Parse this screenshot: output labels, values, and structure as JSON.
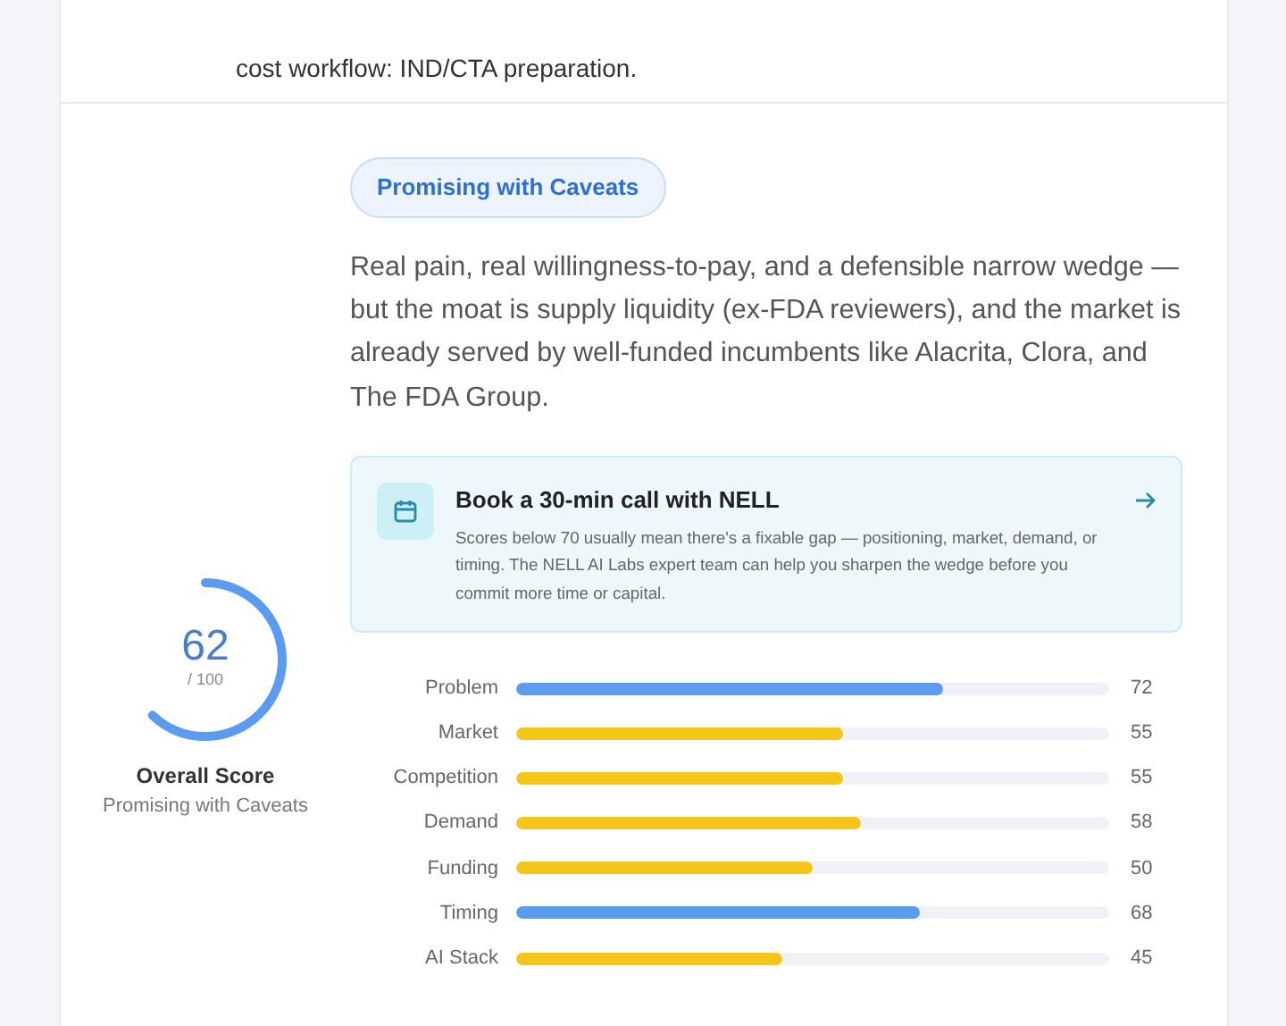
{
  "summary": {
    "text": "cost workflow: IND/CTA preparation."
  },
  "verdict": {
    "badge": "Promising with Caveats",
    "text": "Real pain, real willingness-to-pay, and a defensible narrow wedge — but the moat is supply liquidity (ex-FDA reviewers), and the market is already served by well-funded incumbents like Alacrita, Clora, and The FDA Group."
  },
  "score": {
    "value": "62",
    "out_of": "/ 100",
    "level": 0.62,
    "label": "Overall Score",
    "sublabel": "Promising with Caveats"
  },
  "callout": {
    "title": "Book a 30-min call with NELL",
    "text": "Scores below 70 usually mean there's a fixable gap — positioning, market, demand, or timing. The NELL AI Labs expert team can help you sharpen the wedge before you commit more time or capital."
  },
  "metrics": [
    {
      "name": "Problem",
      "level": 0.72,
      "value": "72",
      "color": "#5b9cf0"
    },
    {
      "name": "Market",
      "level": 0.55,
      "value": "55",
      "color": "#f5c518"
    },
    {
      "name": "Competition",
      "level": 0.55,
      "value": "55",
      "color": "#f5c518"
    },
    {
      "name": "Demand",
      "level": 0.58,
      "value": "58",
      "color": "#f5c518"
    },
    {
      "name": "Funding",
      "level": 0.5,
      "value": "50",
      "color": "#f5c518"
    },
    {
      "name": "Timing",
      "level": 0.68,
      "value": "68",
      "color": "#5b9cf0"
    },
    {
      "name": "AI Stack",
      "level": 0.45,
      "value": "45",
      "color": "#f5c518"
    }
  ]
}
